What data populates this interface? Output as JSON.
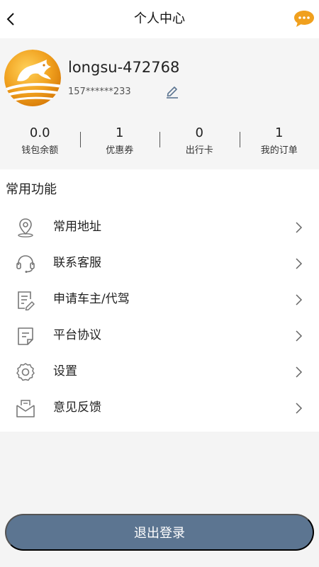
{
  "header": {
    "title": "个人中心",
    "back_icon": "chevron-left-icon",
    "message_icon": "chat-bubble-icon"
  },
  "profile": {
    "username": "longsu-472768",
    "phone": "157******233",
    "edit_icon": "pencil-icon"
  },
  "stats": [
    {
      "value": "0.0",
      "label": "钱包余额"
    },
    {
      "value": "1",
      "label": "优惠券"
    },
    {
      "value": "0",
      "label": "出行卡"
    },
    {
      "value": "1",
      "label": "我的订单"
    }
  ],
  "section": {
    "title": "常用功能"
  },
  "menu": [
    {
      "label": "常用地址",
      "icon": "location-pin-icon"
    },
    {
      "label": "联系客服",
      "icon": "headset-icon"
    },
    {
      "label": "申请车主/代驾",
      "icon": "document-edit-icon"
    },
    {
      "label": "平台协议",
      "icon": "document-icon"
    },
    {
      "label": "设置",
      "icon": "gear-icon"
    },
    {
      "label": "意见反馈",
      "icon": "feedback-envelope-icon"
    }
  ],
  "logout": {
    "label": "退出登录"
  },
  "colors": {
    "accent_orange": "#f0a01e",
    "logout_button": "#5c7591",
    "page_background": "#f4f4f4"
  }
}
